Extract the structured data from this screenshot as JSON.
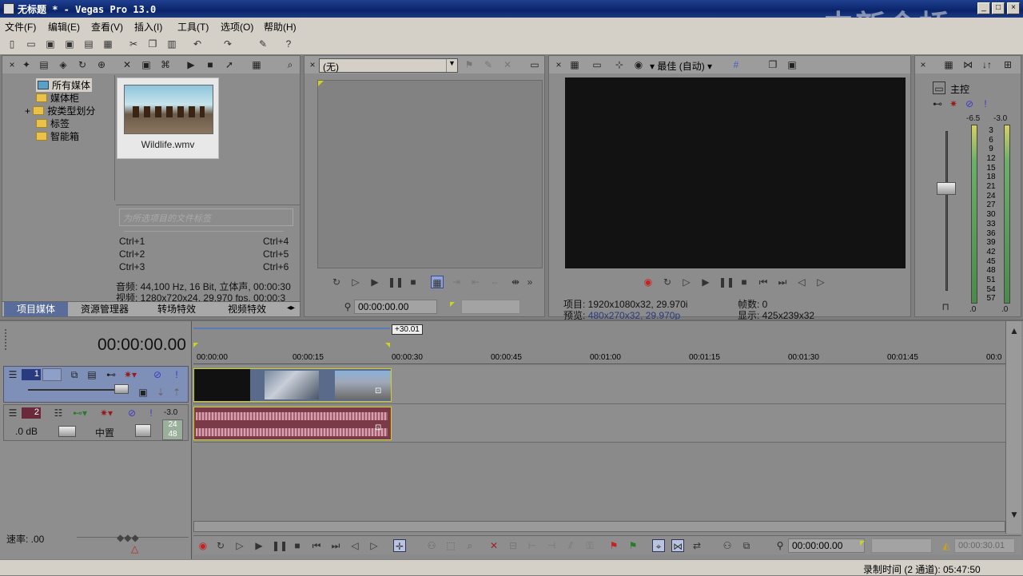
{
  "window": {
    "title": "无标题 * - Vegas Pro 13.0",
    "watermark": "中新金桥"
  },
  "menu": [
    "文件(F)",
    "编辑(E)",
    "查看(V)",
    "插入(I)",
    "工具(T)",
    "选项(O)",
    "帮助(H)"
  ],
  "media": {
    "tree": [
      "所有媒体",
      "媒体柜",
      "按类型划分",
      "标签",
      "智能箱"
    ],
    "file_name": "Wildlife.wmv",
    "tag_placeholder": "为所选项目的文件标签",
    "shortcuts": [
      [
        "Ctrl+1",
        "Ctrl+4"
      ],
      [
        "Ctrl+2",
        "Ctrl+5"
      ],
      [
        "Ctrl+3",
        "Ctrl+6"
      ]
    ],
    "audio_info": "音频: 44,100 Hz, 16 Bit, 立体声, 00:00:30",
    "video_info": "视频: 1280x720x24, 29.970 fps, 00:00:3",
    "tabs": [
      "项目媒体",
      "资源管理器",
      "转场特效",
      "视频特效"
    ]
  },
  "trimmer": {
    "dropdown": "(无)",
    "timecode": "00:00:00.00"
  },
  "preview": {
    "quality": "最佳 (自动)",
    "project": "项目: 1920x1080x32, 29.970i",
    "preview_label": "预览:",
    "preview_value": "480x270x32, 29.970p",
    "frames": "帧数: 0",
    "display": "显示: 425x239x32"
  },
  "mixer": {
    "title": "主控",
    "peak_left": "-6.5",
    "peak_right": "-3.0",
    "scale": [
      "3",
      "6",
      "9",
      "12",
      "15",
      "18",
      "21",
      "24",
      "27",
      "30",
      "33",
      "36",
      "39",
      "42",
      "45",
      "48",
      "51",
      "54",
      "57"
    ],
    "bottom_left": ".0",
    "bottom_right": ".0"
  },
  "timeline": {
    "time": "00:00:00.00",
    "region_label": "+30.01",
    "ruler": [
      "00:00:00",
      "00:00:15",
      "00:00:30",
      "00:00:45",
      "00:01:00",
      "00:01:15",
      "00:01:30",
      "00:01:45",
      "00:0"
    ],
    "track1_num": "1",
    "track2_num": "2",
    "track2_peak": "-3.0",
    "track2_vol": ".0 dB",
    "track2_pan": "中置",
    "track2_meter_a": "24",
    "track2_meter_b": "48",
    "rate": "速率: .00"
  },
  "transport": {
    "timecode": "00:00:00.00",
    "end_time": "00:00:30.01"
  },
  "status": {
    "record": "录制时间 (2 通道): 05:47:50"
  },
  "icons": [
    "new-icon",
    "open-icon",
    "save-icon",
    "cut-icon",
    "copy-icon",
    "paste-icon",
    "undo-icon",
    "redo-icon",
    "play-icon",
    "pause-icon",
    "stop-icon",
    "record-icon",
    "loop-icon"
  ]
}
